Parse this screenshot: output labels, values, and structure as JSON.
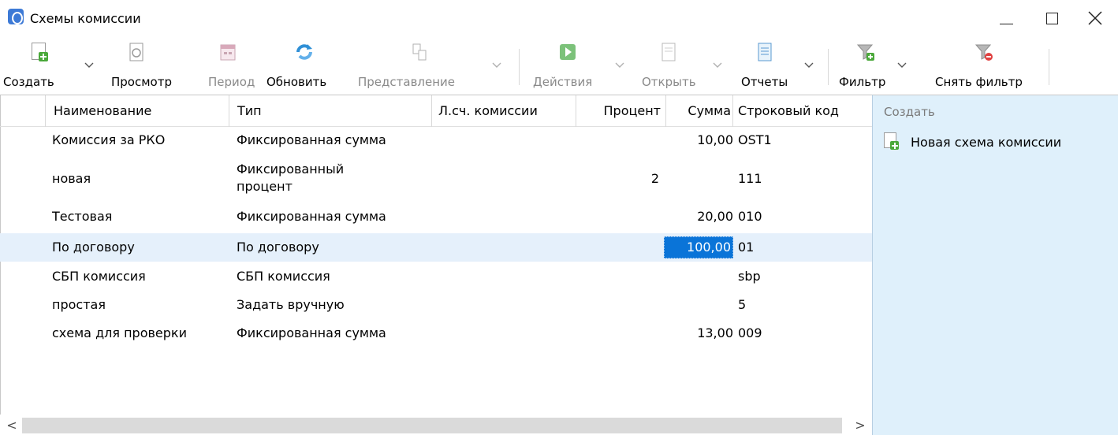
{
  "window": {
    "title": "Схемы комиссии",
    "controls": {
      "minimize": "minimize",
      "maximize": "maximize",
      "close": "close"
    }
  },
  "toolbar": {
    "create": "Создать",
    "view": "Просмотр",
    "period": "Период",
    "refresh": "Обновить",
    "representation": "Представление",
    "actions": "Действия",
    "open": "Открыть",
    "reports": "Отчеты",
    "filter": "Фильтр",
    "clear_filter": "Снять фильтр"
  },
  "grid": {
    "columns": [
      "Наименование",
      "Тип",
      "Л.сч. комиссии",
      "Процент",
      "Сумма",
      "Строковый код"
    ],
    "rows": [
      {
        "name": "Комиссия за РКО",
        "type": "Фиксированная сумма",
        "account": "",
        "percent": "",
        "sum": "10,00",
        "code": "OST1"
      },
      {
        "name": "новая",
        "type": "Фиксированный процент",
        "account": "",
        "percent": "2",
        "sum": "",
        "code": "111"
      },
      {
        "name": "Тестовая",
        "type": "Фиксированная сумма",
        "account": "",
        "percent": "",
        "sum": "20,00",
        "code": "010"
      },
      {
        "name": "По договору",
        "type": "По договору",
        "account": "",
        "percent": "",
        "sum": "100,00",
        "code": "01"
      },
      {
        "name": "СБП комиссия",
        "type": "СБП комиссия",
        "account": "",
        "percent": "",
        "sum": "",
        "code": "sbp"
      },
      {
        "name": "простая",
        "type": "Задать вручную",
        "account": "",
        "percent": "",
        "sum": "",
        "code": "5"
      },
      {
        "name": "схема для проверки",
        "type": "Фиксированная сумма",
        "account": "",
        "percent": "",
        "sum": "13,00",
        "code": "009"
      }
    ],
    "selected_row": 4
  },
  "scrollbar": {
    "left": "<",
    "right": ">"
  },
  "side_panel": {
    "header": "Создать",
    "item": "Новая схема комиссии"
  },
  "colors": {
    "selection": "#e5f0fb",
    "focus_cell": "#0a74d8",
    "side_panel": "#dff0fb"
  }
}
